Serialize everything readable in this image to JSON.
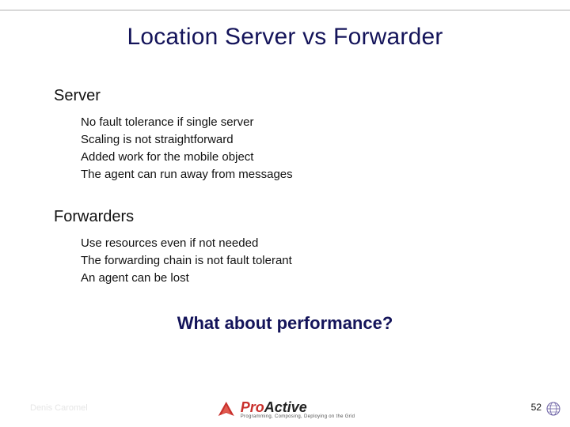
{
  "title": "Location Server vs Forwarder",
  "sections": [
    {
      "heading": "Server",
      "items": [
        "No fault tolerance if single server",
        "Scaling is not straightforward",
        "Added work for the mobile object",
        "The agent can run away from messages"
      ]
    },
    {
      "heading": "Forwarders",
      "items": [
        "Use resources even if not needed",
        "The forwarding chain is not fault tolerant",
        "An agent can be lost"
      ]
    }
  ],
  "closing": "What about performance?",
  "footer": {
    "author": "Denis Caromel",
    "page": "52",
    "logo_pro": "Pro",
    "logo_active": "Active",
    "logo_tagline": "Programming, Composing, Deploying on the Grid"
  }
}
